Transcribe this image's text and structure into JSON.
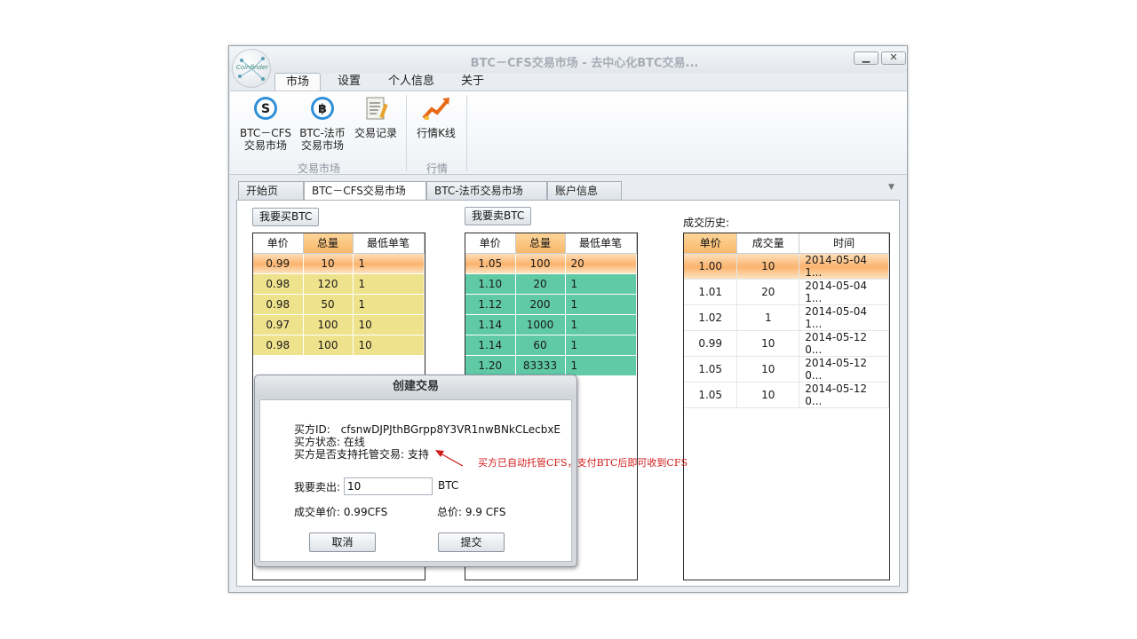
{
  "window": {
    "title": "BTC－CFS交易市场 - 去中心化BTC交易..."
  },
  "logo": {
    "text": "Coinfinder"
  },
  "menu": {
    "tabs": [
      "市场",
      "设置",
      "个人信息",
      "关于"
    ]
  },
  "ribbon": {
    "items": [
      {
        "line1": "BTC－CFS",
        "line2": "交易市场",
        "icon": "cfs-coin-icon"
      },
      {
        "line1": "BTC-法币",
        "line2": "交易市场",
        "icon": "bitcoin-coin-icon"
      },
      {
        "line1": "交易记录",
        "line2": "",
        "icon": "records-icon"
      },
      {
        "line1": "行情K线",
        "line2": "",
        "icon": "chart-trend-icon"
      }
    ],
    "groups": [
      "交易市场",
      "行情"
    ]
  },
  "doc_tabs": [
    {
      "label": "开始页"
    },
    {
      "label": "BTC－CFS交易市场",
      "close": "✕"
    },
    {
      "label": "BTC-法币交易市场"
    },
    {
      "label": "账户信息"
    }
  ],
  "buy": {
    "button": "我要买BTC",
    "headers": [
      "单价",
      "总量",
      "最低单笔"
    ],
    "rows": [
      [
        "0.99",
        "10",
        "1"
      ],
      [
        "0.98",
        "120",
        "1"
      ],
      [
        "0.98",
        "50",
        "1"
      ],
      [
        "0.97",
        "100",
        "10"
      ],
      [
        "0.98",
        "100",
        "10"
      ]
    ]
  },
  "sell": {
    "button": "我要卖BTC",
    "headers": [
      "单价",
      "总量",
      "最低单笔"
    ],
    "rows": [
      [
        "1.05",
        "100",
        "20"
      ],
      [
        "1.10",
        "20",
        "1"
      ],
      [
        "1.12",
        "200",
        "1"
      ],
      [
        "1.14",
        "1000",
        "1"
      ],
      [
        "1.14",
        "60",
        "1"
      ],
      [
        "1.20",
        "83333",
        "1"
      ]
    ]
  },
  "history": {
    "label": "成交历史:",
    "headers": [
      "单价",
      "成交量",
      "时间"
    ],
    "rows": [
      [
        "1.00",
        "10",
        "2014-05-04 1..."
      ],
      [
        "1.01",
        "20",
        "2014-05-04 1..."
      ],
      [
        "1.02",
        "1",
        "2014-05-04 1..."
      ],
      [
        "0.99",
        "10",
        "2014-05-12 0..."
      ],
      [
        "1.05",
        "10",
        "2014-05-12 0..."
      ],
      [
        "1.05",
        "10",
        "2014-05-12 0..."
      ]
    ]
  },
  "dialog": {
    "title": "创建交易",
    "buyer_id_label": "买方ID:",
    "buyer_id": "cfsnwDJPJthBGrpp8Y3VR1nwBNkCLecbxE",
    "buyer_status": "买方状态: 在线",
    "escrow": "买方是否支持托管交易: 支持",
    "sell_label": "我要卖出:",
    "sell_value": "10",
    "sell_unit": "BTC",
    "unit_price": "成交单价: 0.99CFS",
    "total": "总价: 9.9 CFS",
    "cancel": "取消",
    "submit": "提交"
  },
  "annotation": "买方已自动托管CFS，支付BTC后即可收到CFS",
  "colors": {
    "buy_rows": "#efe28c",
    "sell_rows": "#5fcaa5",
    "selected": "#fbb36d",
    "annotation": "#d11a1a"
  }
}
